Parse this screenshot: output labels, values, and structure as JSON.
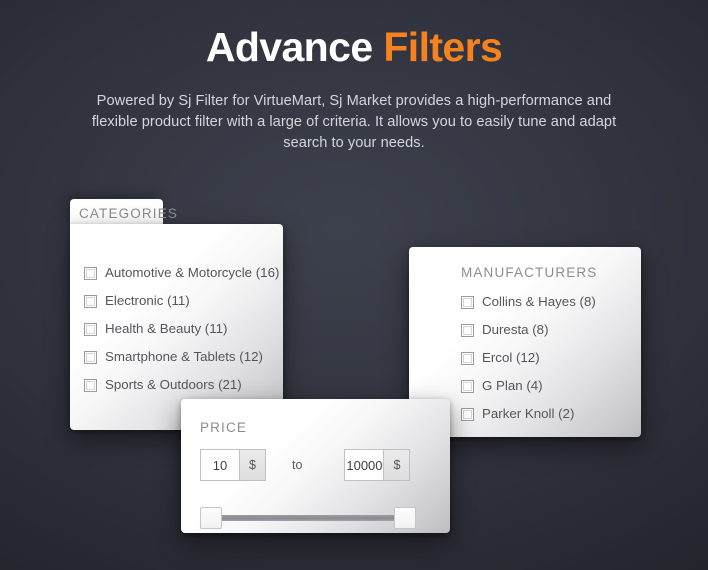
{
  "header": {
    "title_main": "Advance ",
    "title_accent": "Filters",
    "subtitle": "Powered by Sj Filter for VirtueMart, Sj Market provides a high-performance and flexible product filter with a large of criteria. It allows you to easily tune and adapt search to your needs.",
    "accent_color": "#f5821f",
    "background_color": "#33363f"
  },
  "categories": {
    "title": "CATEGORIES",
    "items": [
      {
        "label": "Automotive & Motorcycle (16)",
        "checked": false
      },
      {
        "label": "Electronic (11)",
        "checked": false
      },
      {
        "label": "Health & Beauty (11)",
        "checked": false
      },
      {
        "label": "Smartphone & Tablets (12)",
        "checked": false
      },
      {
        "label": "Sports & Outdoors (21)",
        "checked": false
      }
    ]
  },
  "manufacturers": {
    "title": "MANUFACTURERS",
    "items": [
      {
        "label": "Collins & Hayes (8)",
        "checked": false
      },
      {
        "label": "Duresta (8)",
        "checked": false
      },
      {
        "label": "Ercol (12)",
        "checked": false
      },
      {
        "label": "G Plan (4)",
        "checked": false
      },
      {
        "label": "Parker Knoll (2)",
        "checked": false
      }
    ]
  },
  "price": {
    "title": "PRICE",
    "min_value": "10",
    "max_value": "10000",
    "min_placeholder": "10",
    "max_placeholder": "10000",
    "currency_symbol": "$",
    "to_label": "to",
    "slider_min_percent": 0,
    "slider_max_percent": 100
  }
}
